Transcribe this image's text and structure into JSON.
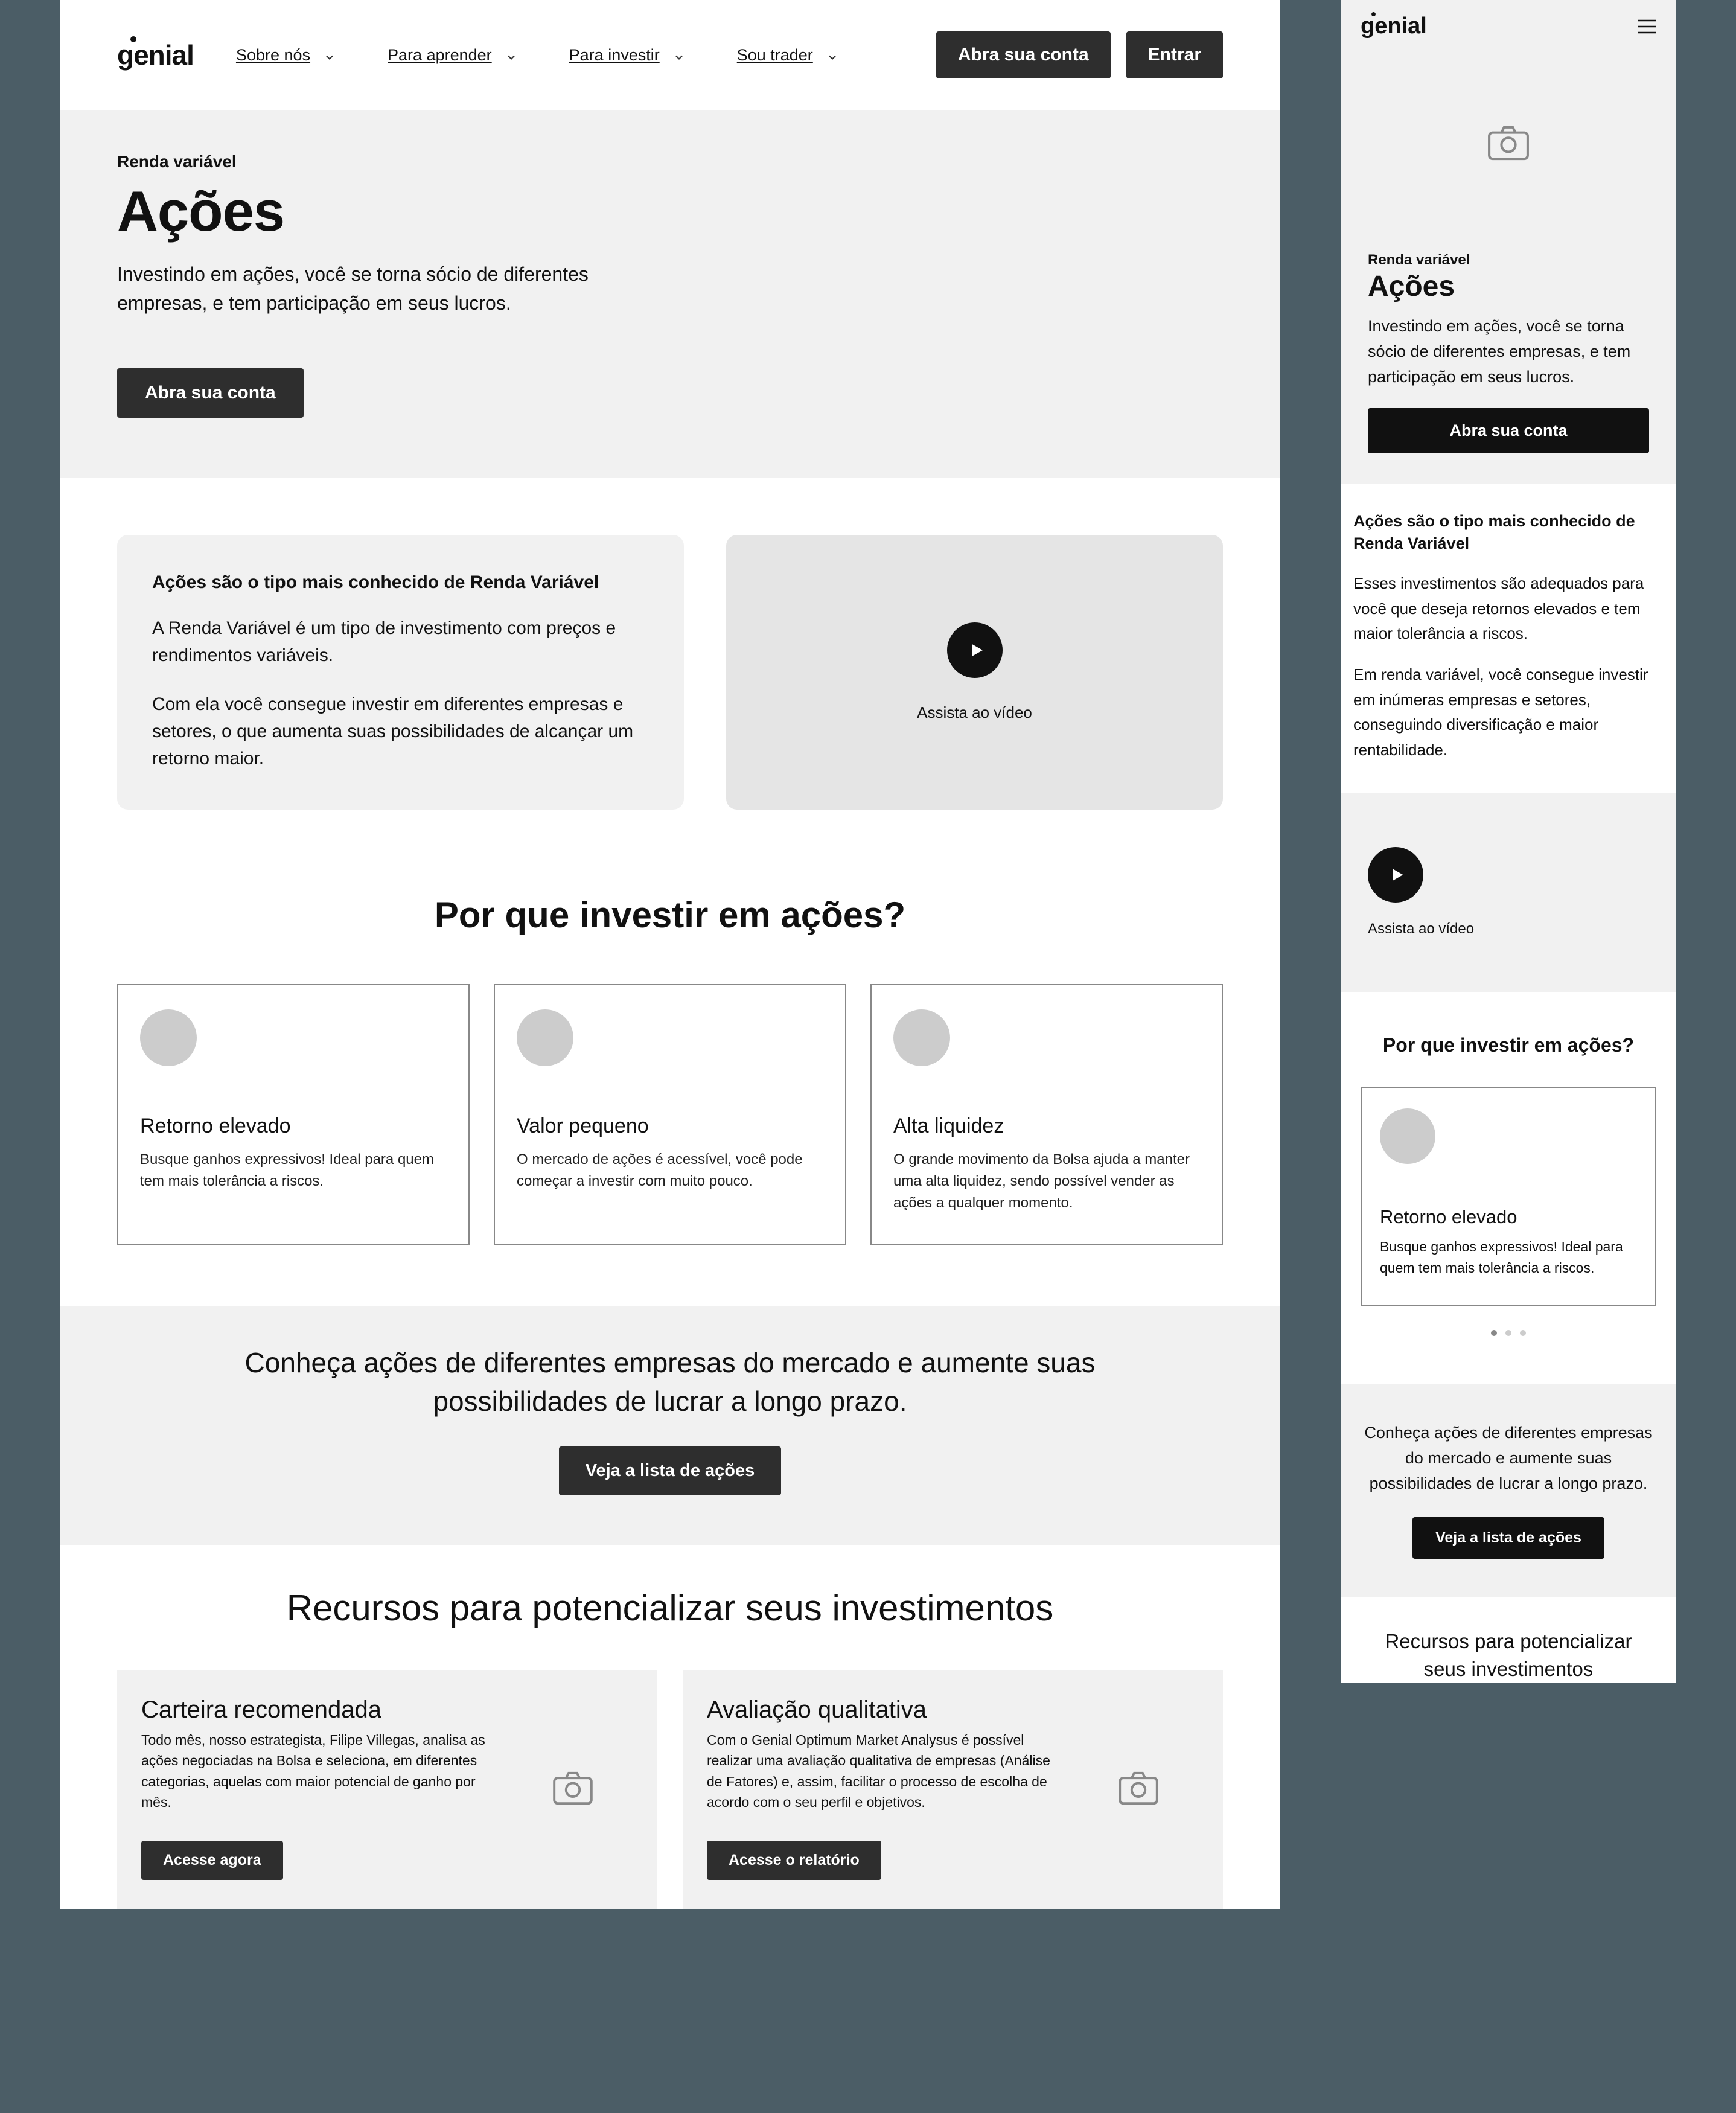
{
  "brand": "genial",
  "desktop": {
    "nav": [
      "Sobre nós",
      "Para aprender",
      "Para investir",
      "Sou trader"
    ],
    "header_buttons": {
      "cta": "Abra sua conta",
      "login": "Entrar"
    },
    "hero": {
      "eyebrow": "Renda variável",
      "title": "Ações",
      "subtitle": "Investindo em ações, você se torna sócio de diferentes empresas, e tem participação em seus lucros.",
      "cta": "Abra sua conta"
    },
    "intro": {
      "heading": "Ações são o tipo mais conhecido de Renda Variável",
      "p1": "A Renda Variável é um tipo de investimento com preços e rendimentos variáveis.",
      "p2": "Com  ela você consegue investir em diferentes empresas e setores, o que aumenta suas possibilidades de alcançar um retorno maior.",
      "video_caption": "Assista ao vídeo"
    },
    "why": {
      "title": "Por que investir em ações?",
      "cards": [
        {
          "title": "Retorno elevado",
          "desc": "Busque ganhos expressivos! Ideal para quem tem mais tolerância a riscos."
        },
        {
          "title": "Valor pequeno",
          "desc": "O mercado de ações é acessível, você pode começar a investir com muito pouco."
        },
        {
          "title": "Alta liquidez",
          "desc": "O grande movimento da Bolsa ajuda a manter uma alta liquidez, sendo possível vender as ações a qualquer momento."
        }
      ]
    },
    "cta_banner": {
      "text": "Conheça ações de diferentes empresas do mercado e aumente suas possibilidades de lucrar a longo prazo.",
      "button": "Veja a lista de ações"
    },
    "resources": {
      "title": "Recursos para potencializar seus investimentos",
      "cards": [
        {
          "title": "Carteira recomendada",
          "desc": "Todo mês, nosso estrategista, Filipe Villegas, analisa as ações negociadas na Bolsa e seleciona, em diferentes categorias, aquelas com maior potencial de ganho por mês.",
          "button": "Acesse agora"
        },
        {
          "title": "Avaliação qualitativa",
          "desc": "Com o Genial Optimum Market Analysus é possível realizar uma avaliação qualitativa de empresas (Análise de Fatores) e, assim, facilitar o processo de escolha de acordo com o seu perfil e objetivos.",
          "button": "Acesse o relatório"
        }
      ]
    }
  },
  "mobile": {
    "hero": {
      "eyebrow": "Renda variável",
      "title": "Ações",
      "subtitle": "Investindo em ações, você se torna sócio de diferentes empresas, e tem participação em seus lucros.",
      "cta": "Abra sua conta"
    },
    "intro": {
      "heading": "Ações são o tipo mais conhecido de Renda Variável",
      "p1": "Esses investimentos são adequados para você que deseja retornos elevados e tem maior tolerância a riscos.",
      "p2": "Em renda variável, você consegue investir em inúmeras empresas e setores, conseguindo diversificação e maior rentabilidade.",
      "video_caption": "Assista ao vídeo"
    },
    "why": {
      "title": "Por que investir em ações?",
      "card": {
        "title": "Retorno elevado",
        "desc": "Busque ganhos expressivos! Ideal para quem tem mais tolerância a riscos."
      }
    },
    "cta_banner": {
      "text": "Conheça ações de diferentes empresas do mercado e aumente suas possibilidades de lucrar a longo prazo.",
      "button": "Veja a lista de ações"
    },
    "resources_title": "Recursos para potencializar seus investimentos"
  }
}
